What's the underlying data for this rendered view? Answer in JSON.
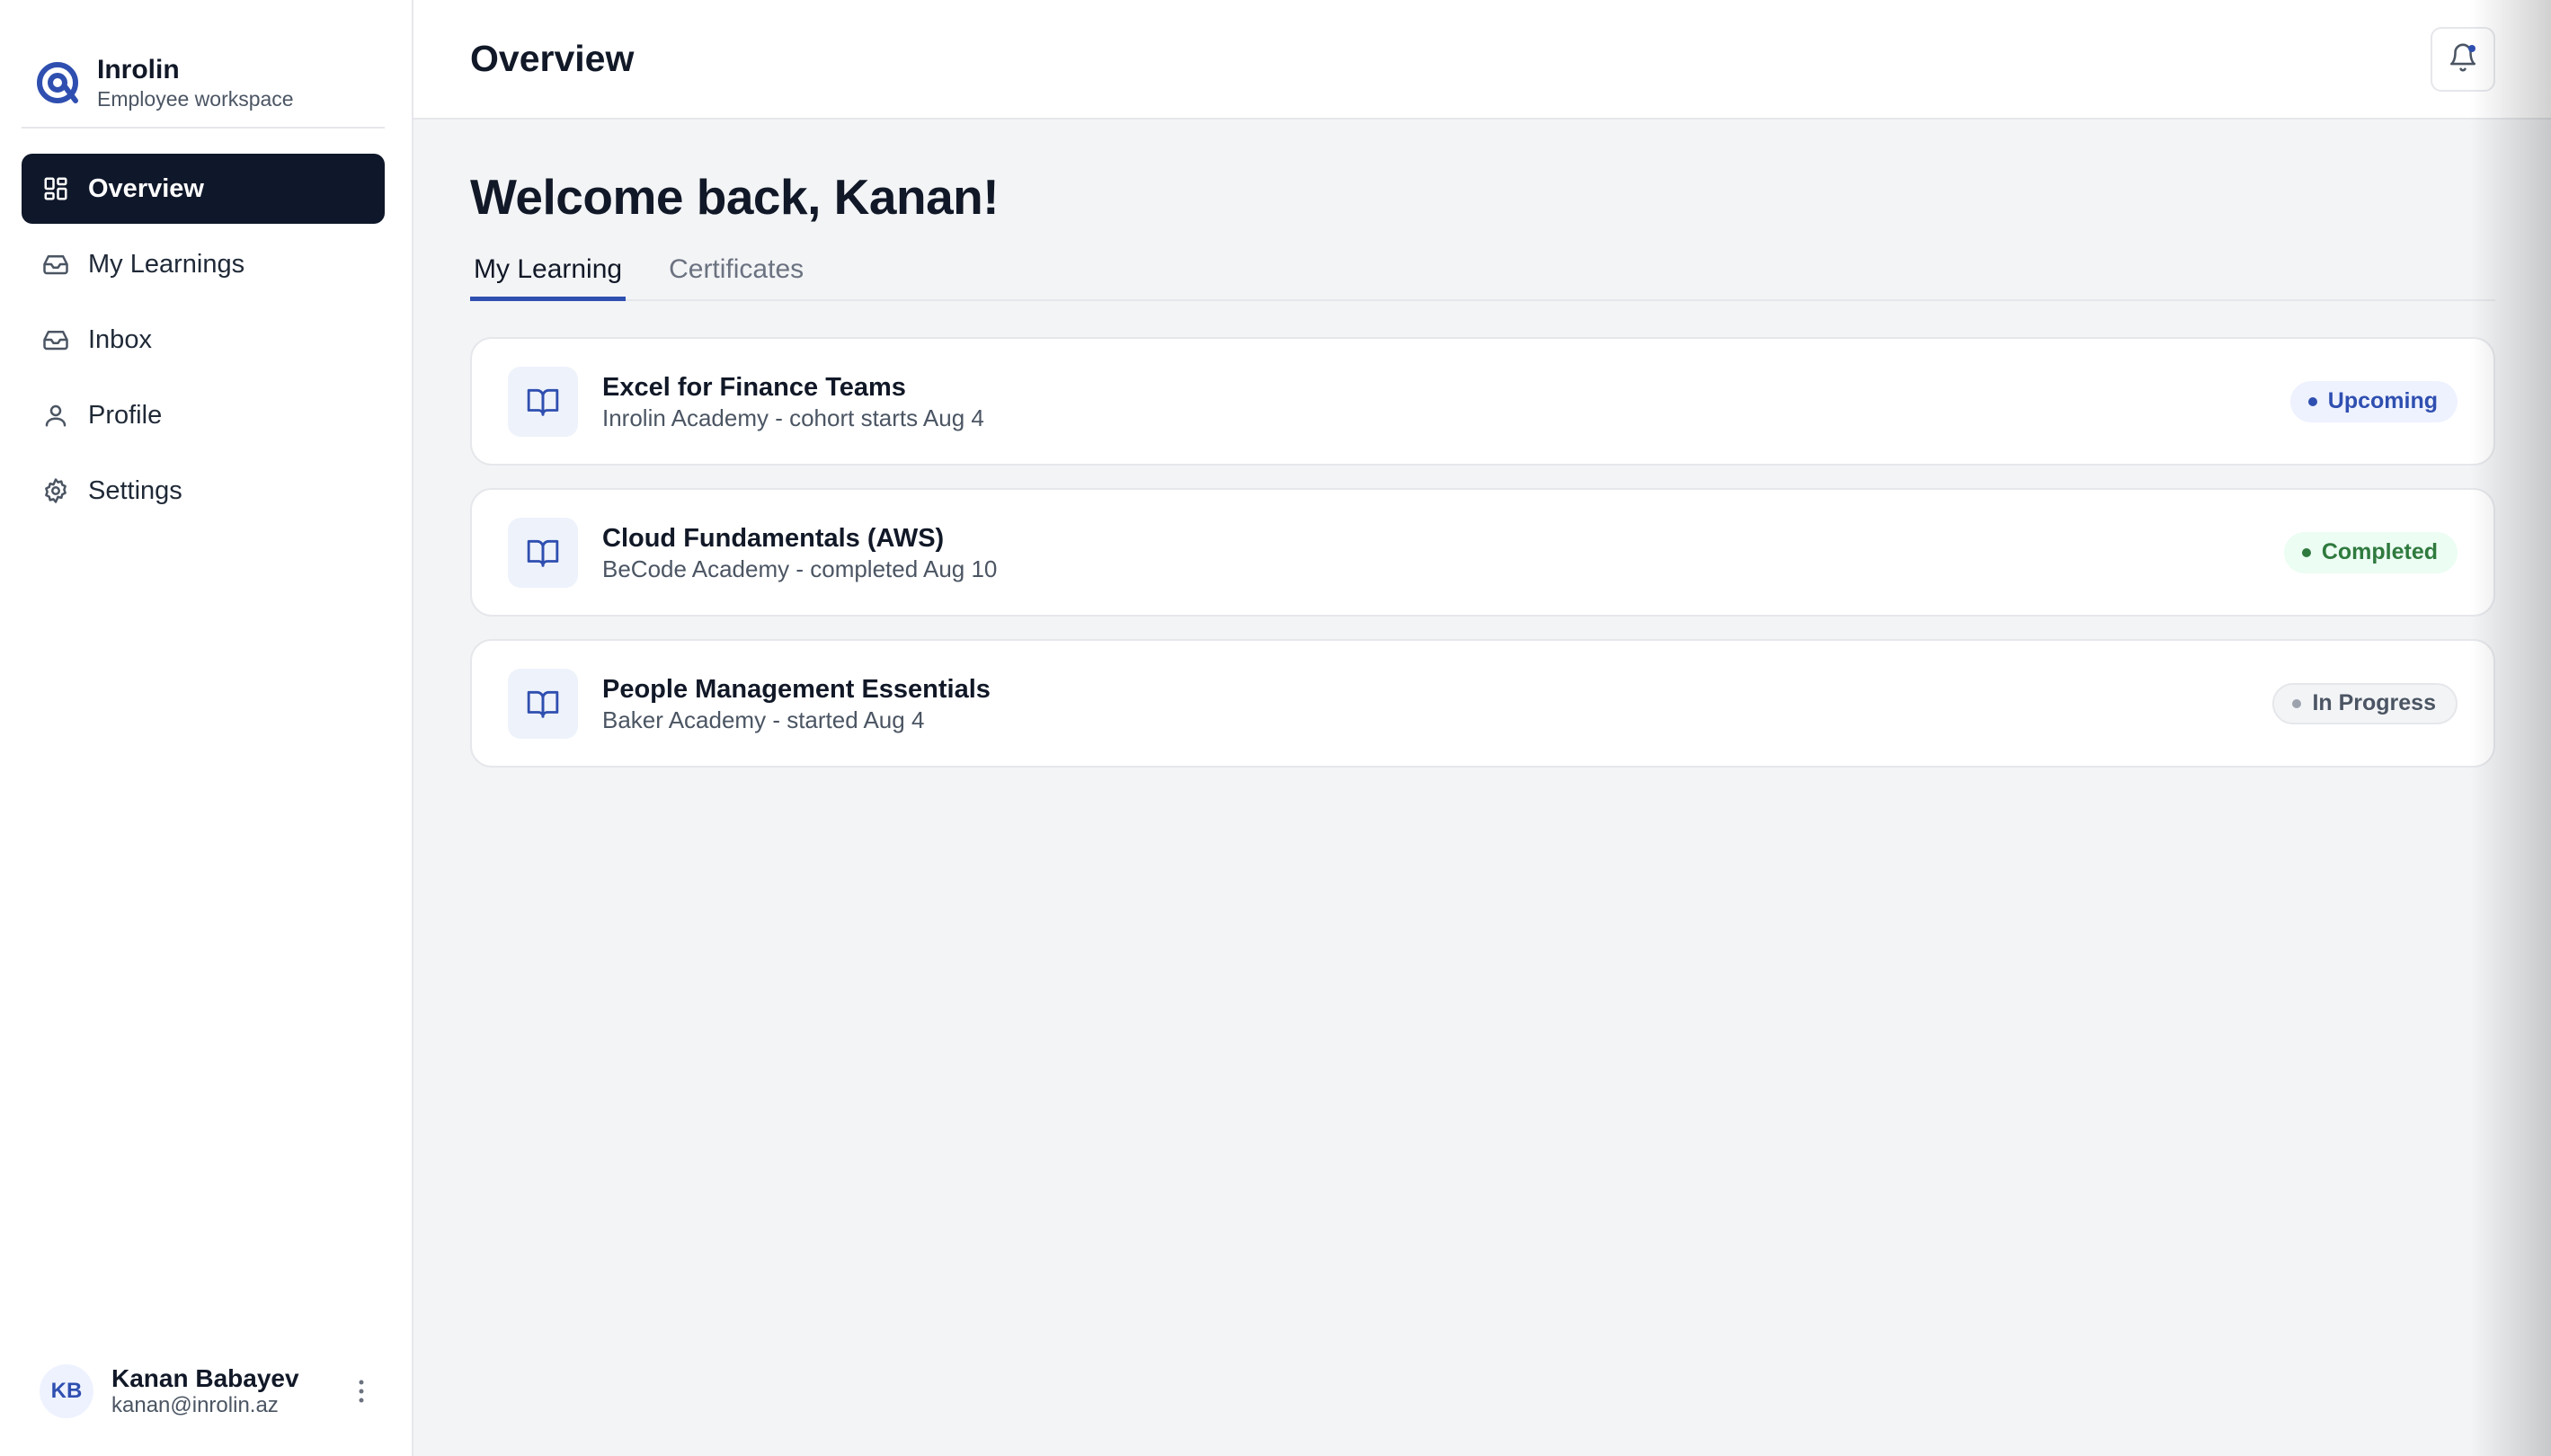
{
  "brand": {
    "name": "Inrolin",
    "subtitle": "Employee workspace"
  },
  "sidebar": {
    "items": [
      {
        "label": "Overview",
        "icon": "grid-icon",
        "active": true
      },
      {
        "label": "My Learnings",
        "icon": "inbox-tray-icon",
        "active": false
      },
      {
        "label": "Inbox",
        "icon": "inbox-tray-icon",
        "active": false
      },
      {
        "label": "Profile",
        "icon": "user-icon",
        "active": false
      },
      {
        "label": "Settings",
        "icon": "gear-icon",
        "active": false
      }
    ]
  },
  "user": {
    "initials": "KB",
    "name": "Kanan Babayev",
    "email": "kanan@inrolin.az"
  },
  "header": {
    "title": "Overview"
  },
  "main": {
    "welcome": "Welcome back, Kanan!",
    "tabs": [
      {
        "label": "My Learning",
        "active": true
      },
      {
        "label": "Certificates",
        "active": false
      }
    ],
    "courses": [
      {
        "title": "Excel for Finance Teams",
        "subtitle": "Inrolin Academy - cohort starts Aug 4",
        "status": "Upcoming"
      },
      {
        "title": "Cloud Fundamentals (AWS)",
        "subtitle": "BeCode Academy - completed Aug 10",
        "status": "Completed"
      },
      {
        "title": "People Management Essentials",
        "subtitle": "Baker Academy - started Aug 4",
        "status": "In Progress"
      }
    ]
  },
  "colors": {
    "accent": "#2f4fb0",
    "nav_active_bg": "#0f172a",
    "completed": "#2f7a3e",
    "background": "#f3f4f6"
  }
}
